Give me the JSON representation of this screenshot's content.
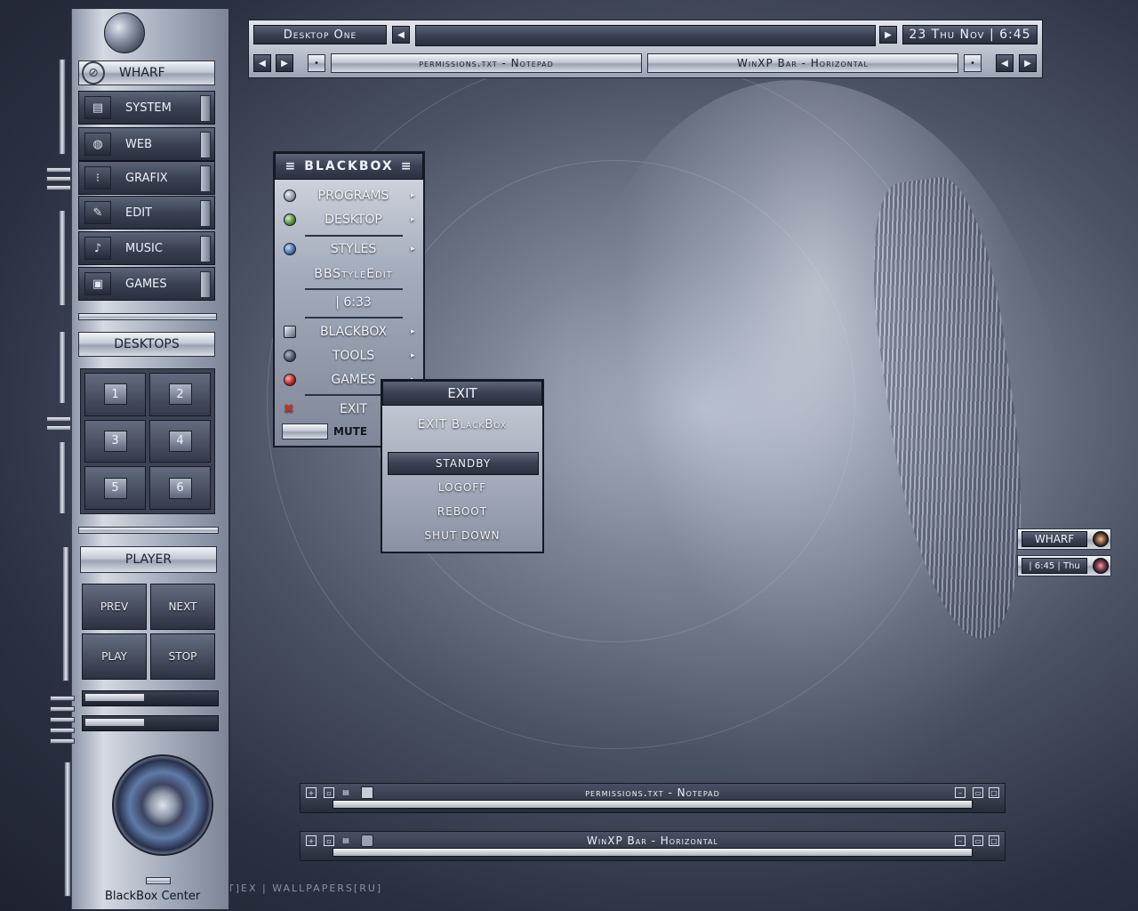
{
  "toolbar": {
    "workspace": "Desktop One",
    "clock": "23 Thu Nov | 6:45",
    "tasks": [
      "permissions.txt - Notepad",
      "WinXP Bar - Horizontal"
    ]
  },
  "wharf": {
    "title": "WHARF",
    "items": [
      {
        "label": "SYSTEM",
        "icon": "system-icon"
      },
      {
        "label": "WEB",
        "icon": "globe-icon"
      },
      {
        "label": "GRAFIX",
        "icon": "palette-icon"
      },
      {
        "label": "EDIT",
        "icon": "edit-icon"
      },
      {
        "label": "MUSIC",
        "icon": "music-icon"
      },
      {
        "label": "GAMES",
        "icon": "games-icon"
      }
    ],
    "desktops_label": "DESKTOPS",
    "desktops": [
      "1",
      "2",
      "3",
      "4",
      "5",
      "6"
    ],
    "player_label": "PLAYER",
    "player_buttons": [
      "PREV",
      "NEXT",
      "PLAY",
      "STOP"
    ],
    "sliders": [
      0.45,
      0.45
    ],
    "center_label": "BlackBox Center"
  },
  "menu": {
    "title": "BLACKBOX",
    "items": [
      {
        "label": "PROGRAMS",
        "submenu": true,
        "color": "#8d93a3"
      },
      {
        "label": "DESKTOP",
        "submenu": true,
        "color": "#4f8a3c"
      },
      {
        "label": "STYLES",
        "submenu": true,
        "color": "#3c6ea8"
      },
      {
        "label": "BBStyleEdit",
        "submenu": false
      },
      {
        "label": "| 6:33",
        "submenu": false
      },
      {
        "label": "BLACKBOX",
        "submenu": true,
        "color": "#9aa0ad"
      },
      {
        "label": "TOOLS",
        "submenu": true,
        "color": "#5a5f6a"
      },
      {
        "label": "GAMES",
        "submenu": true,
        "color": "#b02222"
      },
      {
        "label": "EXIT",
        "submenu": false,
        "color": "#c0302a"
      }
    ],
    "mute": "MUTE"
  },
  "exit_menu": {
    "title": "EXIT",
    "items": [
      "EXIT BlackBox",
      "STANDBY",
      "LOGOFF",
      "REBOOT",
      "SHUT DOWN"
    ]
  },
  "mini_wharf": {
    "title": "WHARF",
    "clock": "| 6:45 | Thu"
  },
  "taskbars": [
    {
      "title": "permissions.txt - Notepad",
      "progress": 0.98
    },
    {
      "title": "WinXP Bar - Horizontal",
      "progress": 0.98
    }
  ],
  "footer_credit": "T]EX  |  WALLPAPERS[RU]"
}
